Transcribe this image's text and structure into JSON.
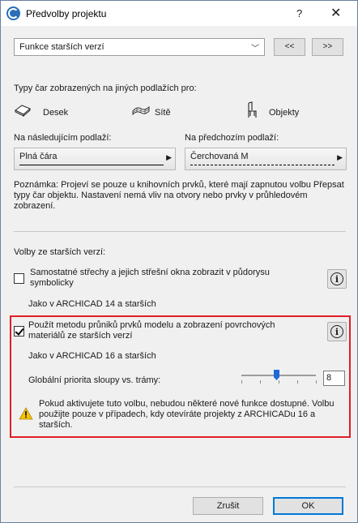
{
  "window": {
    "title": "Předvolby projektu",
    "help": "?",
    "close": "✕"
  },
  "panel_select": {
    "value": "Funkce starších verzí",
    "prev": "<<",
    "next": ">>"
  },
  "line_types": {
    "heading": "Typy čar zobrazených na jiných podlažích pro:",
    "slabs": "Desek",
    "meshes": "Sítě",
    "objects": "Objekty",
    "next_story_label": "Na následujícím podlaží:",
    "next_story_value": "Plná čára",
    "prev_story_label": "Na předchozím podlaží:",
    "prev_story_value": "Čerchovaná M",
    "note": "Poznámka: Projeví se pouze u knihovních prvků, které mají zapnutou volbu Přepsat typy čar objektu. Nastavení nemá vliv na otvory nebo prvky v průhledovém zobrazení."
  },
  "legacy": {
    "heading": "Volby ze starších verzí:",
    "opt1_label": "Samostatné střechy a jejich střešní okna zobrazit v půdorysu symbolicky",
    "opt1_checked": false,
    "opt1_sub": "Jako v ARCHICAD 14 a starších",
    "opt2_label": "Použít metodu průniků prvků modelu a zobrazení povrchových materiálů ze starších verzí",
    "opt2_checked": true,
    "opt2_sub": "Jako v ARCHICAD 16 a starších",
    "priority_label": "Globální priorita sloupy vs. trámy:",
    "priority_value": "8",
    "warning": "Pokud aktivujete tuto volbu, nebudou některé nové funkce dostupné. Volbu použijte pouze v případech, kdy otevíráte projekty z ARCHICADu 16 a starších."
  },
  "footer": {
    "cancel": "Zrušit",
    "ok": "OK"
  },
  "colors": {
    "highlight": "#e01e26",
    "slider_thumb": "#1e6ad6",
    "warning_yellow": "#f5c400"
  },
  "icons": [
    "app-icon",
    "slab-icon",
    "mesh-icon",
    "chair-icon",
    "info-icon",
    "warning-icon"
  ]
}
